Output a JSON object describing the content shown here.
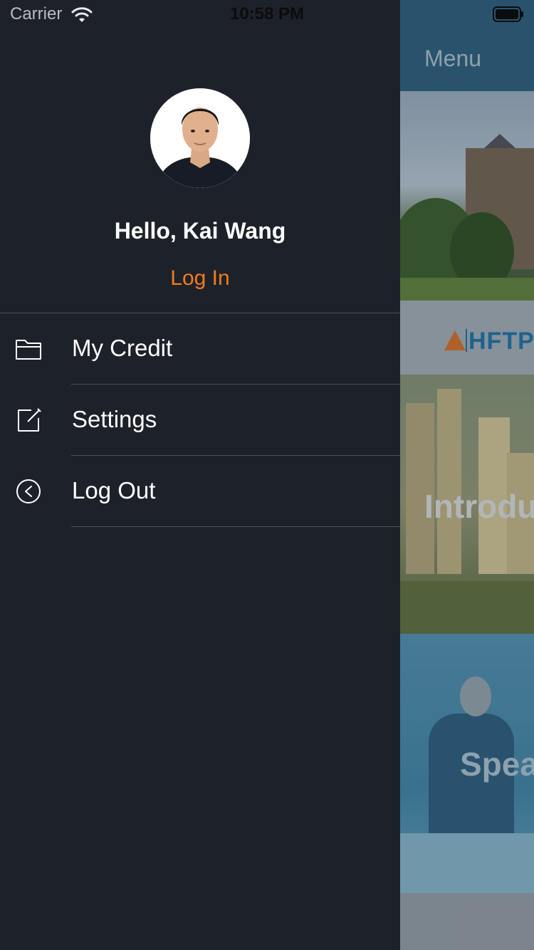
{
  "status_bar": {
    "carrier": "Carrier",
    "time": "10:58 PM",
    "wifi_icon": "wifi-icon",
    "battery_icon": "battery-icon"
  },
  "drawer": {
    "avatar_icon": "user-avatar",
    "greeting": "Hello, Kai Wang",
    "login_label": "Log In",
    "accent_color": "#f27c1a",
    "background_color": "#1d222a",
    "menu": [
      {
        "label": "My Credit",
        "icon": "folder-icon"
      },
      {
        "label": "Settings",
        "icon": "edit-icon"
      },
      {
        "label": "Log Out",
        "icon": "back-circle-icon"
      }
    ]
  },
  "main": {
    "nav_title": "Menu",
    "logo_text": "HFTP",
    "banners": [
      {
        "title": "Introdu"
      },
      {
        "title": "Spea"
      }
    ],
    "nav_color": "#2d5c78"
  }
}
